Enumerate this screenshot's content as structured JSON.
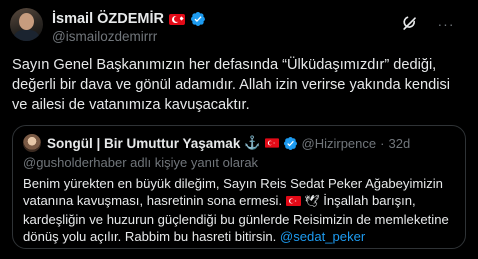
{
  "tweet": {
    "author_name": "İsmail ÖZDEMİR",
    "author_handle": "@ismailozdemirrr",
    "text": "Sayın Genel Başkanımızın her defasında “Ülküdaşımızdır” dediği, değerli bir dava ve gönül adamıdır. Allah izin verirse yakında kendisi ve ailesi de vatanımıza kavuşacaktır.",
    "more_label": "···"
  },
  "quote": {
    "author_name": "Songül | Bir Umuttur Yaşamak",
    "author_handle": "@Hizirpence",
    "dot": "·",
    "time": "32d",
    "reply_context": "@gusholderhaber adlı kişiye yanıt olarak",
    "text_part1": "Benim yürekten en büyük dileğim, Sayın Reis Sedat Peker Ağabeyimizin vatanına kavuşması, hasretinin sona ermesi. ",
    "text_part2": " İnşallah barışın, kardeşliğin ve huzurun güçlendiği bu günlerde Reisimizin de memleketine dönüş yolu açılır. Rabbim bu hasreti bitirsin. ",
    "mention": "@sedat_peker",
    "anchor_glyph": "⚓",
    "dove_glyph": "🕊"
  },
  "colors": {
    "background": "#000000",
    "text": "#e7e9ea",
    "secondary": "#71767b",
    "accent": "#1d9bf0",
    "border": "#2f3336",
    "flag_red": "#e30a17"
  },
  "icons": [
    "avatar",
    "turkish-flag-icon",
    "verified-badge-icon",
    "grok-icon",
    "more-icon",
    "anchor-icon",
    "dove-icon"
  ]
}
